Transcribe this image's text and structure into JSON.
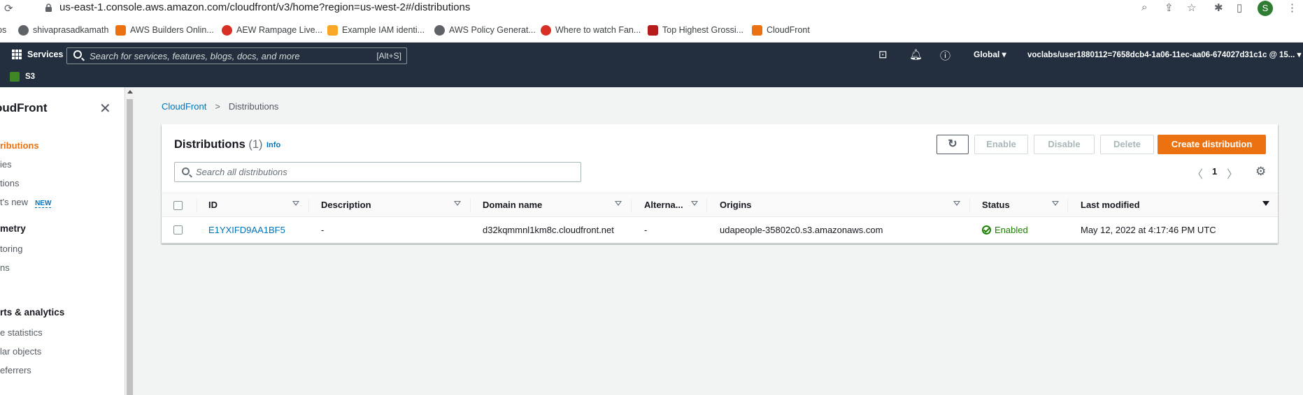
{
  "browser": {
    "url": "us-east-1.console.aws.amazon.com/cloudfront/v3/home?region=us-west-2#/distributions",
    "profile_initial": "S",
    "bookmarks": [
      {
        "label": "ps",
        "color": "#ffffff"
      },
      {
        "label": "shivaprasadkamath",
        "color": "#5f6368"
      },
      {
        "label": "AWS Builders Onlin...",
        "color": "#ec7211"
      },
      {
        "label": "AEW Rampage Live...",
        "color": "#d93025"
      },
      {
        "label": "Example IAM identi...",
        "color": "#f9a825"
      },
      {
        "label": "AWS Policy Generat...",
        "color": "#5f6368"
      },
      {
        "label": "Where to watch Fan...",
        "color": "#d93025"
      },
      {
        "label": "Top Highest Grossi...",
        "color": "#b71c1c"
      },
      {
        "label": "CloudFront",
        "color": "#ec7211"
      }
    ]
  },
  "aws_header": {
    "services_label": "Services",
    "search_placeholder": "Search for services, features, blogs, docs, and more",
    "search_shortcut": "[Alt+S]",
    "region": "Global ▾",
    "account": "voclabs/user1880112=7658dcb4-1a06-11ec-aa06-674027d31c1c @ 15... ▾",
    "favorite": "S3"
  },
  "sidebar": {
    "title": "oudFront",
    "items": [
      {
        "label": "ributions",
        "type": "active"
      },
      {
        "label": "ies",
        "type": "item"
      },
      {
        "label": "tions",
        "type": "item"
      },
      {
        "label": "t's new",
        "type": "item",
        "badge": "NEW"
      },
      {
        "label": "metry",
        "type": "head"
      },
      {
        "label": "toring",
        "type": "item"
      },
      {
        "label": "ns",
        "type": "item"
      },
      {
        "label": "rts & analytics",
        "type": "head"
      },
      {
        "label": "e statistics",
        "type": "item"
      },
      {
        "label": "lar objects",
        "type": "item"
      },
      {
        "label": "eferrers",
        "type": "item"
      }
    ]
  },
  "breadcrumb": {
    "root": "CloudFront",
    "sep": ">",
    "current": "Distributions"
  },
  "panel": {
    "title": "Distributions",
    "count": "(1)",
    "info": "Info",
    "buttons": {
      "refresh": "↻",
      "enable": "Enable",
      "disable": "Disable",
      "delete": "Delete",
      "create": "Create distribution"
    },
    "search_placeholder": "Search all distributions",
    "page": "1",
    "columns": [
      "ID",
      "Description",
      "Domain name",
      "Alterna...",
      "Origins",
      "Status",
      "Last modified"
    ],
    "rows": [
      {
        "id": "E1YXIFD9AA1BF5",
        "description": "-",
        "domain": "d32kqmmnl1km8c.cloudfront.net",
        "alternate": "-",
        "origins": "udapeople-35802c0.s3.amazonaws.com",
        "status": "Enabled",
        "last_modified": "May 12, 2022 at 4:17:46 PM UTC"
      }
    ]
  },
  "colors": {
    "aws_orange": "#ec7211",
    "link_blue": "#0073bb",
    "nav_bg": "#232f3e",
    "success_green": "#1d8102"
  }
}
